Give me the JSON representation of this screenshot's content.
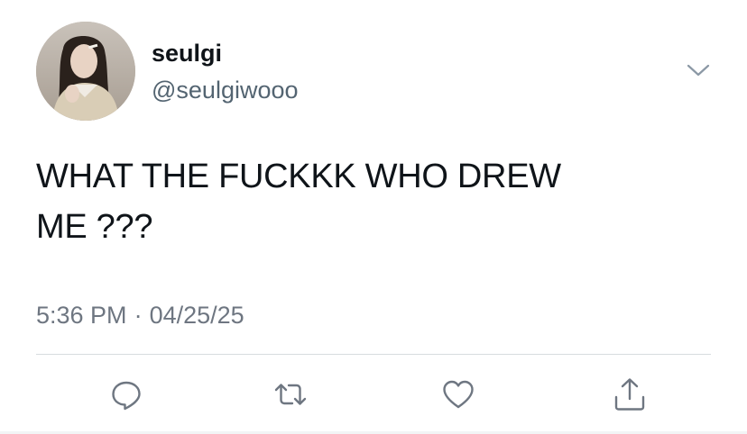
{
  "user": {
    "display_name": "seulgi",
    "handle": "@seulgiwooo",
    "avatar_icon": "profile-photo"
  },
  "tweet": {
    "text_line_1": "WHAT THE FUCKKK WHO DREW",
    "text_line_2": "ME ???",
    "time": "5:36 PM",
    "separator": "·",
    "date": "04/25/25"
  },
  "actions": {
    "reply_icon": "reply-icon",
    "retweet_icon": "retweet-icon",
    "like_icon": "heart-icon",
    "share_icon": "share-icon",
    "more_icon": "chevron-down-icon"
  },
  "colors": {
    "text_primary": "#0f1419",
    "text_secondary": "#536471",
    "icon_gray": "#6e7681",
    "divider": "#d7dcdf"
  }
}
